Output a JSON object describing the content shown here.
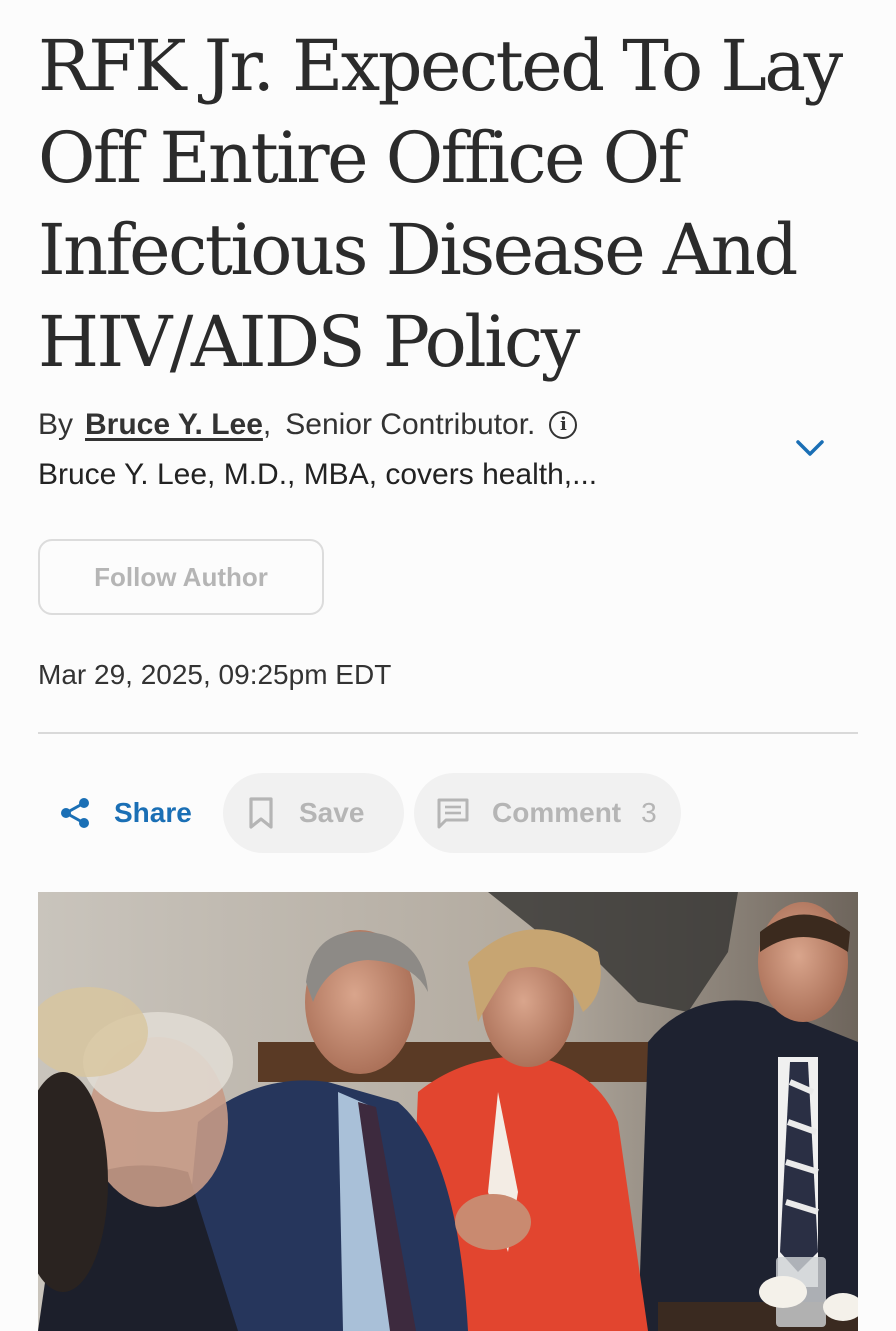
{
  "article": {
    "headline": "RFK Jr. Expected To Lay Off Entire Office Of Infectious Disease And HIV/AIDS Policy",
    "byline": {
      "prefix": "By",
      "author": "Bruce Y. Lee",
      "separator": ",",
      "title": "Senior Contributor.",
      "info_icon": "info-icon",
      "bio": "Bruce Y. Lee, M.D., MBA, covers health,...",
      "expand_icon": "chevron-down-icon"
    },
    "follow_label": "Follow Author",
    "date": "Mar 29, 2025, 09:25pm EDT"
  },
  "actions": {
    "share": {
      "label": "Share",
      "icon": "share-icon"
    },
    "save": {
      "label": "Save",
      "icon": "bookmark-icon"
    },
    "comment": {
      "label": "Comment",
      "count": "3",
      "icon": "comment-icon"
    }
  },
  "colors": {
    "accent": "#1a6fb5",
    "text": "#2b2b2b",
    "muted": "#b5b5b5",
    "divider": "#d9d9d9",
    "pill_bg": "#f1f1f1"
  }
}
